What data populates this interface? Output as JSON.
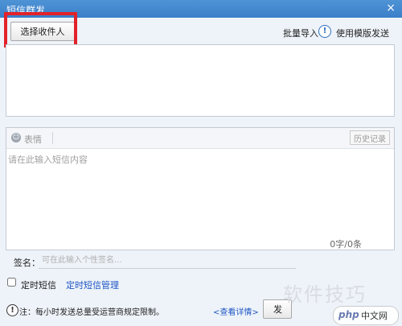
{
  "window": {
    "title": "短信群发",
    "close_glyph": "×"
  },
  "recipients": {
    "select_label": "选择收件人",
    "highlight_color": "#e2222a",
    "batch_import_label": "批量导入",
    "info_glyph": "!",
    "template_send_label": "使用模版发送"
  },
  "composer": {
    "emoji_label": "表情",
    "emoji_icon": "smiley-icon",
    "history_label": "历史记录",
    "placeholder": "请在此输入短信内容",
    "char_count": "0字/0条"
  },
  "signature": {
    "label": "签名：",
    "placeholder": "可在此输入个性签名..."
  },
  "schedule": {
    "label": "定时短信",
    "manage_label": "定时短信管理",
    "checked": false
  },
  "footer": {
    "note_glyph": "!",
    "note_text": "注：每小时发送总量受运营商规定限制。",
    "details_link": "<查看详情>",
    "send_label": "发"
  },
  "watermark": {
    "text": "软件技巧",
    "php": "php",
    "cn": "中文网"
  }
}
